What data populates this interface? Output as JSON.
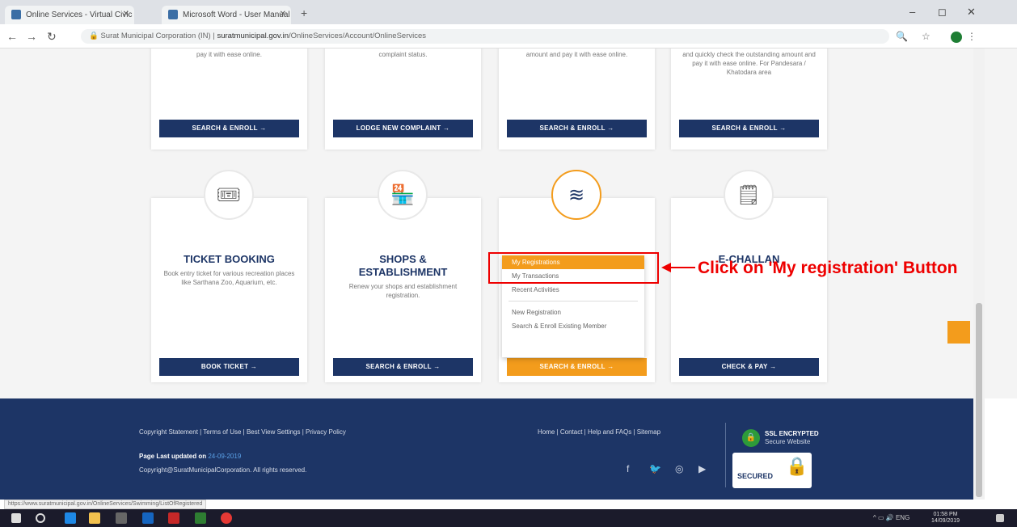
{
  "browser": {
    "tabs": [
      {
        "label": "Online Services - Virtual Civic Ce"
      },
      {
        "label": "Microsoft Word - User Manual t"
      }
    ],
    "url_prefix": "Surat Municipal Corporation (IN) | ",
    "url_domain": "suratmunicipal.gov.in",
    "url_path": "/OnlineServices/Account/OnlineServices"
  },
  "top_cards": [
    {
      "desc": "pay it with ease online.",
      "cta": "SEARCH & ENROLL →"
    },
    {
      "desc": "complaint status.",
      "cta": "LODGE NEW COMPLAINT →"
    },
    {
      "desc": "amount and pay it with ease online.",
      "cta": "SEARCH & ENROLL →"
    },
    {
      "desc": "and quickly check the outstanding amount and pay it with ease online. For Pandesara / Khatodara area",
      "cta": "SEARCH & ENROLL →"
    }
  ],
  "cards": [
    {
      "title": "TICKET BOOKING",
      "desc": "Book entry ticket for various recreation places like Sarthana Zoo, Aquarium, etc.",
      "cta": "BOOK TICKET →",
      "icon": "ticket-icon"
    },
    {
      "title": "SHOPS & ESTABLISHMENT",
      "desc": "Renew your shops and establishment registration.",
      "cta": "SEARCH & ENROLL →",
      "icon": "shop-icon"
    },
    {
      "title": "",
      "desc": "",
      "cta": "SEARCH & ENROLL →",
      "icon": "swimming-pool-icon"
    },
    {
      "title": "E-CHALLAN",
      "desc": "",
      "cta": "CHECK & PAY →",
      "icon": "challan-icon"
    }
  ],
  "dropdown": {
    "items": [
      "My Registrations",
      "My Transactions",
      "Recent Activities"
    ],
    "items2": [
      "New Registration",
      "Search & Enroll Existing Member"
    ]
  },
  "annotation": {
    "text": "Click on 'My registration' Button",
    "color": "#e00000"
  },
  "footer": {
    "links": "Copyright Statement | Terms of Use | Best View Settings | Privacy Policy",
    "links_right": "Home | Contact | Help and FAQs | Sitemap",
    "updated_label": "Page Last updated on ",
    "updated_date": "24-09-2019",
    "copyright": "Copyright@SuratMunicipalCorporation. All rights reserved.",
    "ssl_line1": "SSL ENCRYPTED",
    "ssl_line2": "Secure Website",
    "secured": "SECURED"
  },
  "status_url": "https://www.suratmunicipal.gov.in/OnlineServices/Swimming/ListOfRegistered",
  "taskbar": {
    "lang": "ENG",
    "time": "01:58 PM",
    "date": "14/09/2019"
  },
  "colors": {
    "navy": "#1d3566",
    "orange": "#f39c1c",
    "green": "#2d9b3a"
  }
}
